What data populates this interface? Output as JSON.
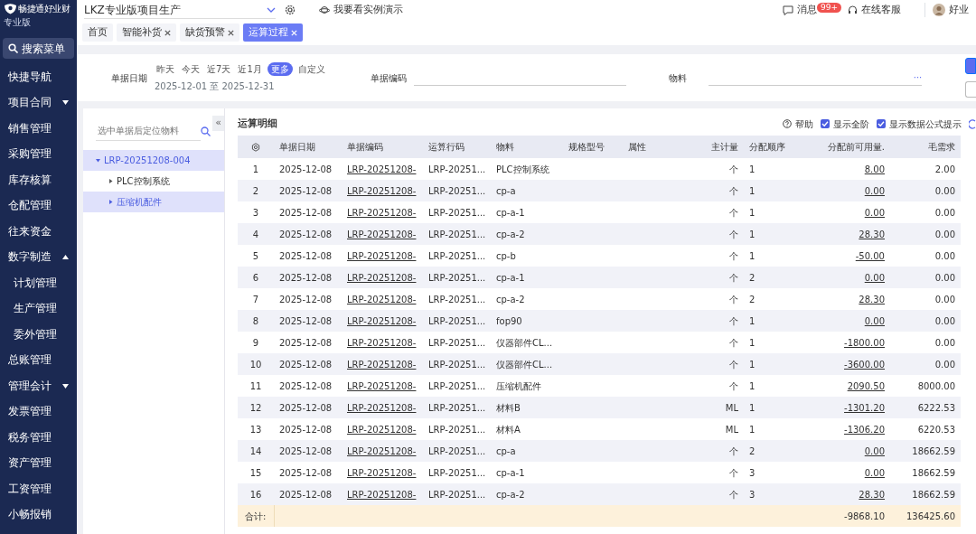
{
  "brand": {
    "name": "畅捷通好业财",
    "edition": "专业版"
  },
  "sidebar": {
    "search": "搜索菜单",
    "items": [
      {
        "label": "快捷导航",
        "kind": "item"
      },
      {
        "label": "项目合同",
        "kind": "group",
        "expanded": false
      },
      {
        "label": "销售管理",
        "kind": "item"
      },
      {
        "label": "采购管理",
        "kind": "item"
      },
      {
        "label": "库存核算",
        "kind": "item"
      },
      {
        "label": "仓配管理",
        "kind": "item"
      },
      {
        "label": "往来资金",
        "kind": "item"
      },
      {
        "label": "数字制造",
        "kind": "group",
        "expanded": true,
        "children": [
          {
            "label": "计划管理"
          },
          {
            "label": "生产管理"
          },
          {
            "label": "委外管理"
          }
        ]
      },
      {
        "label": "总账管理",
        "kind": "item"
      },
      {
        "label": "管理会计",
        "kind": "group",
        "expanded": false
      },
      {
        "label": "发票管理",
        "kind": "item"
      },
      {
        "label": "税务管理",
        "kind": "item"
      },
      {
        "label": "资产管理",
        "kind": "item"
      },
      {
        "label": "工资管理",
        "kind": "item"
      },
      {
        "label": "小畅报销",
        "kind": "item"
      }
    ]
  },
  "topbar": {
    "project": "LKZ专业版项目生产",
    "demo": "我要看实例演示",
    "messages": "消息",
    "message_badge": "99+",
    "support": "在线客服",
    "user": "好业"
  },
  "tabs": [
    {
      "label": "首页",
      "closable": false,
      "selected": false
    },
    {
      "label": "智能补货",
      "closable": true,
      "selected": false
    },
    {
      "label": "缺货预警",
      "closable": true,
      "selected": false
    },
    {
      "label": "运算过程",
      "closable": true,
      "selected": true
    }
  ],
  "filters": {
    "date_label": "单据日期",
    "quick": [
      {
        "label": "昨天",
        "selected": false
      },
      {
        "label": "今天",
        "selected": false
      },
      {
        "label": "近7天",
        "selected": false
      },
      {
        "label": "近1月",
        "selected": false
      },
      {
        "label": "更多",
        "selected": true
      },
      {
        "label": "自定义",
        "selected": false
      }
    ],
    "date_range": "2025-12-01 至 2025-12-31",
    "doc_code_label": "单据编码",
    "material_label": "物料",
    "more": "···"
  },
  "tree": {
    "placeholder": "选中单据后定位物料",
    "collapse": "«",
    "nodes": [
      {
        "label": "LRP-20251208-004",
        "expanded": true,
        "selected": true,
        "children": [
          {
            "label": "PLC控制系统",
            "expanded": false,
            "selected": false
          },
          {
            "label": "压缩机配件",
            "expanded": false,
            "selected": true
          }
        ]
      }
    ]
  },
  "table": {
    "title": "运算明细",
    "help": "帮助",
    "options": [
      {
        "label": "显示全阶",
        "checked": true
      },
      {
        "label": "显示数据公式提示",
        "checked": true
      }
    ],
    "columns": [
      "单据日期",
      "单据编码",
      "运算行码",
      "物料",
      "规格型号",
      "属性",
      "主计量",
      "分配顺序",
      "分配前可用量.",
      "毛需求"
    ],
    "rows": [
      {
        "no": "1",
        "date": "2025-12-08",
        "doc_code": "LRP-20251208-",
        "line_code": "LRP-20251...",
        "material": "PLC控制系统",
        "unit": "个",
        "order": "1",
        "available": "8.00",
        "gross": "2.00"
      },
      {
        "no": "2",
        "date": "2025-12-08",
        "doc_code": "LRP-20251208-",
        "line_code": "LRP-20251...",
        "material": "cp-a",
        "unit": "个",
        "order": "1",
        "available": "0.00",
        "gross": "0.00"
      },
      {
        "no": "3",
        "date": "2025-12-08",
        "doc_code": "LRP-20251208-",
        "line_code": "LRP-20251...",
        "material": "cp-a-1",
        "unit": "个",
        "order": "1",
        "available": "0.00",
        "gross": "0.00"
      },
      {
        "no": "4",
        "date": "2025-12-08",
        "doc_code": "LRP-20251208-",
        "line_code": "LRP-20251...",
        "material": "cp-a-2",
        "unit": "个",
        "order": "1",
        "available": "28.30",
        "gross": "0.00"
      },
      {
        "no": "5",
        "date": "2025-12-08",
        "doc_code": "LRP-20251208-",
        "line_code": "LRP-20251...",
        "material": "cp-b",
        "unit": "个",
        "order": "1",
        "available": "-50.00",
        "gross": "0.00"
      },
      {
        "no": "6",
        "date": "2025-12-08",
        "doc_code": "LRP-20251208-",
        "line_code": "LRP-20251...",
        "material": "cp-a-1",
        "unit": "个",
        "order": "2",
        "available": "0.00",
        "gross": "0.00"
      },
      {
        "no": "7",
        "date": "2025-12-08",
        "doc_code": "LRP-20251208-",
        "line_code": "LRP-20251...",
        "material": "cp-a-2",
        "unit": "个",
        "order": "2",
        "available": "28.30",
        "gross": "0.00"
      },
      {
        "no": "8",
        "date": "2025-12-08",
        "doc_code": "LRP-20251208-",
        "line_code": "LRP-20251...",
        "material": "fop90",
        "unit": "个",
        "order": "1",
        "available": "0.00",
        "gross": "0.00"
      },
      {
        "no": "9",
        "date": "2025-12-08",
        "doc_code": "LRP-20251208-",
        "line_code": "LRP-20251...",
        "material": "仪器部件CL...",
        "unit": "个",
        "order": "1",
        "available": "-1800.00",
        "gross": "0.00"
      },
      {
        "no": "10",
        "date": "2025-12-08",
        "doc_code": "LRP-20251208-",
        "line_code": "LRP-20251...",
        "material": "仪器部件CL...",
        "unit": "个",
        "order": "1",
        "available": "-3600.00",
        "gross": "0.00"
      },
      {
        "no": "11",
        "date": "2025-12-08",
        "doc_code": "LRP-20251208-",
        "line_code": "LRP-20251...",
        "material": "压缩机配件",
        "unit": "个",
        "order": "1",
        "available": "2090.50",
        "gross": "8000.00"
      },
      {
        "no": "12",
        "date": "2025-12-08",
        "doc_code": "LRP-20251208-",
        "line_code": "LRP-20251...",
        "material": "材料B",
        "unit": "ML",
        "order": "1",
        "available": "-1301.20",
        "gross": "6222.53"
      },
      {
        "no": "13",
        "date": "2025-12-08",
        "doc_code": "LRP-20251208-",
        "line_code": "LRP-20251...",
        "material": "材料A",
        "unit": "ML",
        "order": "1",
        "available": "-1306.20",
        "gross": "6220.53"
      },
      {
        "no": "14",
        "date": "2025-12-08",
        "doc_code": "LRP-20251208-",
        "line_code": "LRP-20251...",
        "material": "cp-a",
        "unit": "个",
        "order": "2",
        "available": "0.00",
        "gross": "18662.59"
      },
      {
        "no": "15",
        "date": "2025-12-08",
        "doc_code": "LRP-20251208-",
        "line_code": "LRP-20251...",
        "material": "cp-a-1",
        "unit": "个",
        "order": "3",
        "available": "0.00",
        "gross": "18662.59"
      },
      {
        "no": "16",
        "date": "2025-12-08",
        "doc_code": "LRP-20251208-",
        "line_code": "LRP-20251...",
        "material": "cp-a-2",
        "unit": "个",
        "order": "3",
        "available": "28.30",
        "gross": "18662.59"
      }
    ],
    "total": {
      "label": "合计:",
      "available": "-9868.10",
      "gross": "136425.60"
    }
  }
}
